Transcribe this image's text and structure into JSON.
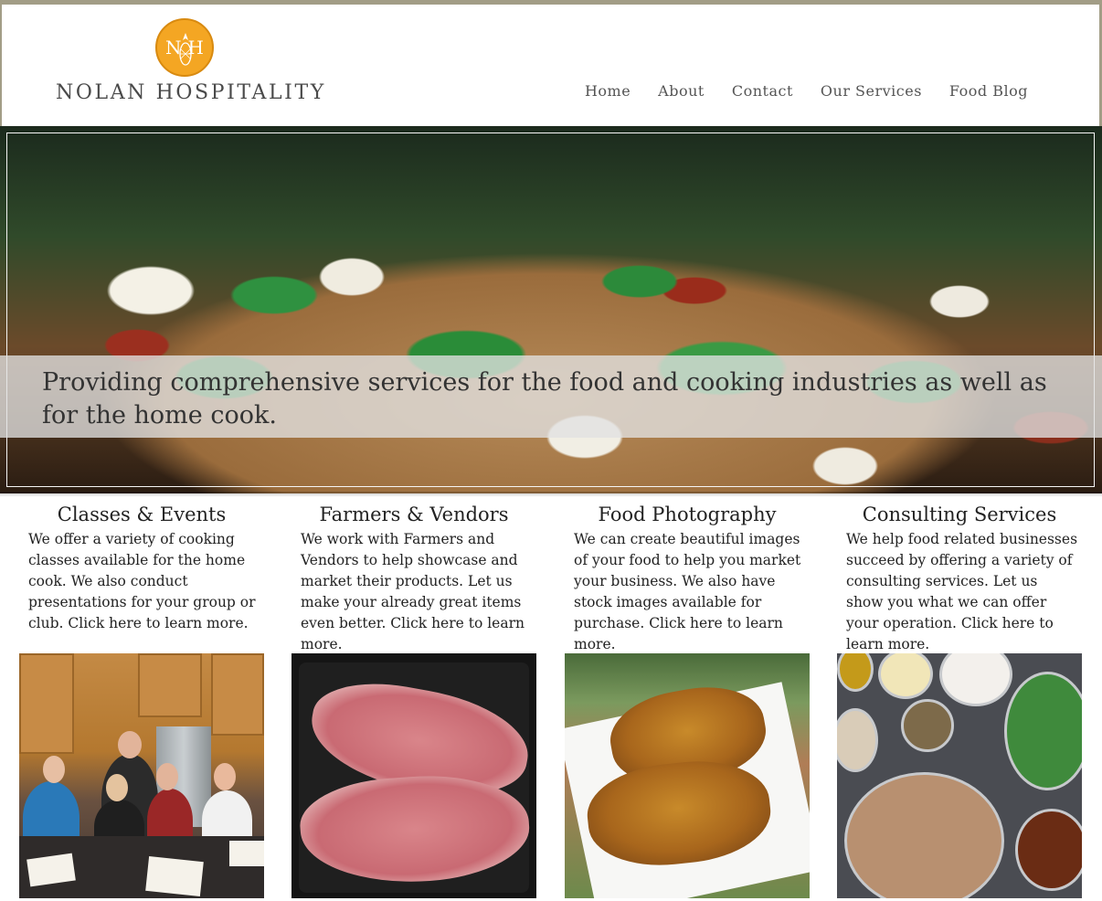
{
  "brand": {
    "name": "NOLAN HOSPITALITY",
    "logo_left_letter": "N",
    "logo_right_letter": "H",
    "logo_color": "#f4a623"
  },
  "nav": {
    "items": [
      "Home",
      "About",
      "Contact",
      "Our Services",
      "Food Blog"
    ]
  },
  "hero": {
    "caption": "Providing comprehensive services for the food and cooking industries as well as for the home cook."
  },
  "services": [
    {
      "title": "Classes & Events",
      "text": "We offer a variety of cooking classes available for the home cook.  We also conduct presentations for your group or club.  Click here to learn more."
    },
    {
      "title": "Farmers & Vendors",
      "text": "We work with Farmers and Vendors to help showcase and market their products.  Let us make your already great items even better.  Click here to learn more."
    },
    {
      "title": "Food Photography",
      "text": "We can create beautiful images of your food to help you market your business.  We also have stock images available for purchase.  Click here to learn more."
    },
    {
      "title": "Consulting Services",
      "text": "We help food related businesses succeed by offering a variety of consulting services.  Let us show you what we can offer your operation. Click here to learn more."
    }
  ]
}
